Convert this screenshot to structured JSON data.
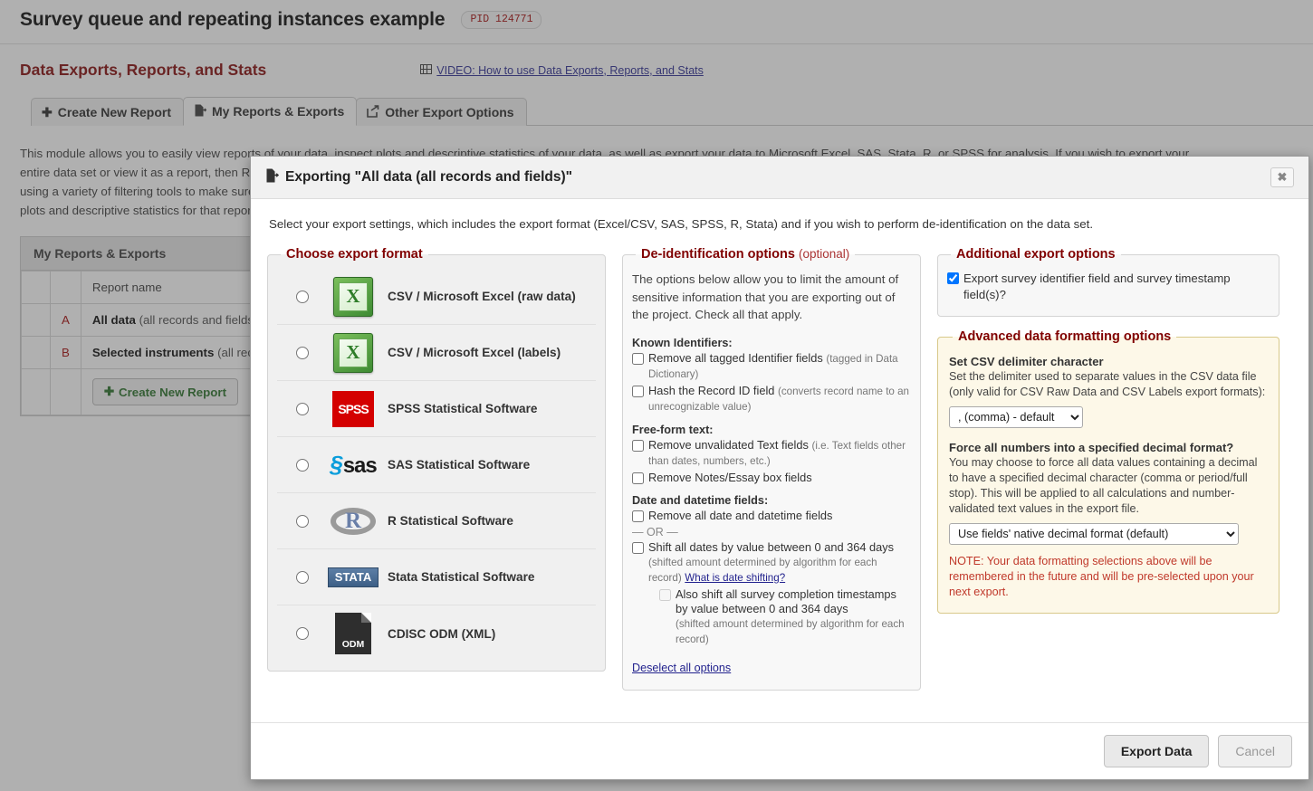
{
  "project": {
    "title": "Survey queue and repeating instances example",
    "pid_badge": "PID 124771"
  },
  "page": {
    "section_title": "Data Exports, Reports, and Stats",
    "video_link": "VIDEO: How to use Data Exports, Reports, and Stats",
    "film_icon": "film-icon",
    "tabs": [
      {
        "label": "Create New Report",
        "icon": "plus-icon",
        "glyph": "✚",
        "active": false
      },
      {
        "label": "My Reports & Exports",
        "icon": "export-file-icon",
        "glyph": "🗎",
        "active": true
      },
      {
        "label": "Other Export Options",
        "icon": "share-out-icon",
        "glyph": "↱",
        "active": false
      }
    ],
    "intro_paragraph": "This module allows you to easily view reports of your data, inspect plots and descriptive statistics of your data, as well as export your data to Microsoft Excel, SAS, Stata, R, or SPSS for analysis. If you wish to export your entire data set or view it as a report, then Report A is the right choice. You may also create your own custom reports below (if you have such privileges) in which you can filter the report to specific fields, records, or events using a variety of filtering tools to make sure you get the exact data you want. Once you have created a report, you may view it as a webpage, export it to a file in a chosen format (Excel, SAS, Stata, SPSS, R), or view the plots and descriptive statistics for that report."
  },
  "reports_table": {
    "title": "My Reports & Exports",
    "columns": [
      "",
      "",
      "Report name"
    ],
    "rows": [
      {
        "letter": "A",
        "name_bold": "All data",
        "name_rest": "(all records and fields)"
      },
      {
        "letter": "B",
        "name_bold": "Selected instruments",
        "name_rest": "(all records and fields)"
      }
    ],
    "create_button": "Create New Report",
    "create_button_glyph": "✚"
  },
  "modal": {
    "title": "Exporting \"All data (all records and fields)\"",
    "title_icon": "export-file-icon",
    "close_icon": "close-icon",
    "close_glyph": "✖",
    "intro": "Select your export settings, which includes the export format (Excel/CSV, SAS, SPSS, R, Stata) and if you wish to perform de-identification on the data set.",
    "format_panel": {
      "legend": "Choose export format",
      "selected_value": null,
      "options": [
        {
          "id": "csvraw",
          "label": "CSV / Microsoft Excel (raw data)",
          "icon": "excel-icon",
          "checked": false
        },
        {
          "id": "csvlabel",
          "label": "CSV / Microsoft Excel (labels)",
          "icon": "excel-icon",
          "checked": false
        },
        {
          "id": "spss",
          "label": "SPSS Statistical Software",
          "icon": "spss-icon",
          "checked": false
        },
        {
          "id": "sas",
          "label": "SAS Statistical Software",
          "icon": "sas-icon",
          "checked": false
        },
        {
          "id": "r",
          "label": "R Statistical Software",
          "icon": "r-icon",
          "checked": false
        },
        {
          "id": "stata",
          "label": "Stata Statistical Software",
          "icon": "stata-icon",
          "checked": false
        },
        {
          "id": "odm",
          "label": "CDISC ODM (XML)",
          "icon": "odm-file-icon",
          "checked": false
        }
      ]
    },
    "deid_panel": {
      "legend": "De-identification options",
      "legend_optional": "(optional)",
      "intro": "The options below allow you to limit the amount of sensitive information that you are exporting out of the project. Check all that apply.",
      "group_known": "Known Identifiers:",
      "opt_remove_tagged": "Remove all tagged Identifier fields",
      "opt_remove_tagged_hint": "(tagged in Data Dictionary)",
      "opt_hash_record": "Hash the Record ID field",
      "opt_hash_record_hint": "(converts record name to an unrecognizable value)",
      "group_freeform": "Free-form text:",
      "opt_remove_unvalidated": "Remove unvalidated Text fields",
      "opt_remove_unvalidated_hint": "(i.e. Text fields other than dates, numbers, etc.)",
      "opt_remove_notes": "Remove Notes/Essay box fields",
      "group_dates": "Date and datetime fields:",
      "opt_remove_dates": "Remove all date and datetime fields",
      "or_separator": "— OR —",
      "opt_shift_dates": "Shift all dates by value between 0 and 364 days",
      "opt_shift_dates_hint": "(shifted amount determined by algorithm for each record)",
      "date_shift_link": "What is date shifting?",
      "opt_shift_surveys": "Also shift all survey completion timestamps by value between 0 and 364 days",
      "opt_shift_surveys_hint": "(shifted amount determined by algorithm for each record)",
      "deselect_link": "Deselect all options"
    },
    "additional_panel": {
      "legend": "Additional export options",
      "opt_survey_identifier": "Export survey identifier field and survey timestamp field(s)?",
      "opt_survey_identifier_checked": true
    },
    "advanced_panel": {
      "legend": "Advanced data formatting options",
      "delimiter_heading": "Set CSV delimiter character",
      "delimiter_desc": "Set the delimiter used to separate values in the CSV data file (only valid for CSV Raw Data and CSV Labels export formats):",
      "delimiter_value": ", (comma) - default",
      "delimiter_options": [
        ", (comma) - default"
      ],
      "decimal_heading": "Force all numbers into a specified decimal format?",
      "decimal_desc": "You may choose to force all data values containing a decimal to have a specified decimal character (comma or period/full stop). This will be applied to all calculations and number-validated text values in the export file.",
      "decimal_value": "Use fields' native decimal format (default)",
      "decimal_options": [
        "Use fields' native decimal format (default)"
      ],
      "note": "NOTE: Your data formatting selections above will be remembered in the future and will be pre-selected upon your next export."
    },
    "footer": {
      "export_label": "Export Data",
      "cancel_label": "Cancel"
    }
  },
  "colors": {
    "brand_maroon": "#800000",
    "link_blue": "#23238E",
    "note_red": "#c0392b",
    "advanced_panel_bg": "#fdf8e8",
    "advanced_panel_border": "#d8c98a"
  }
}
